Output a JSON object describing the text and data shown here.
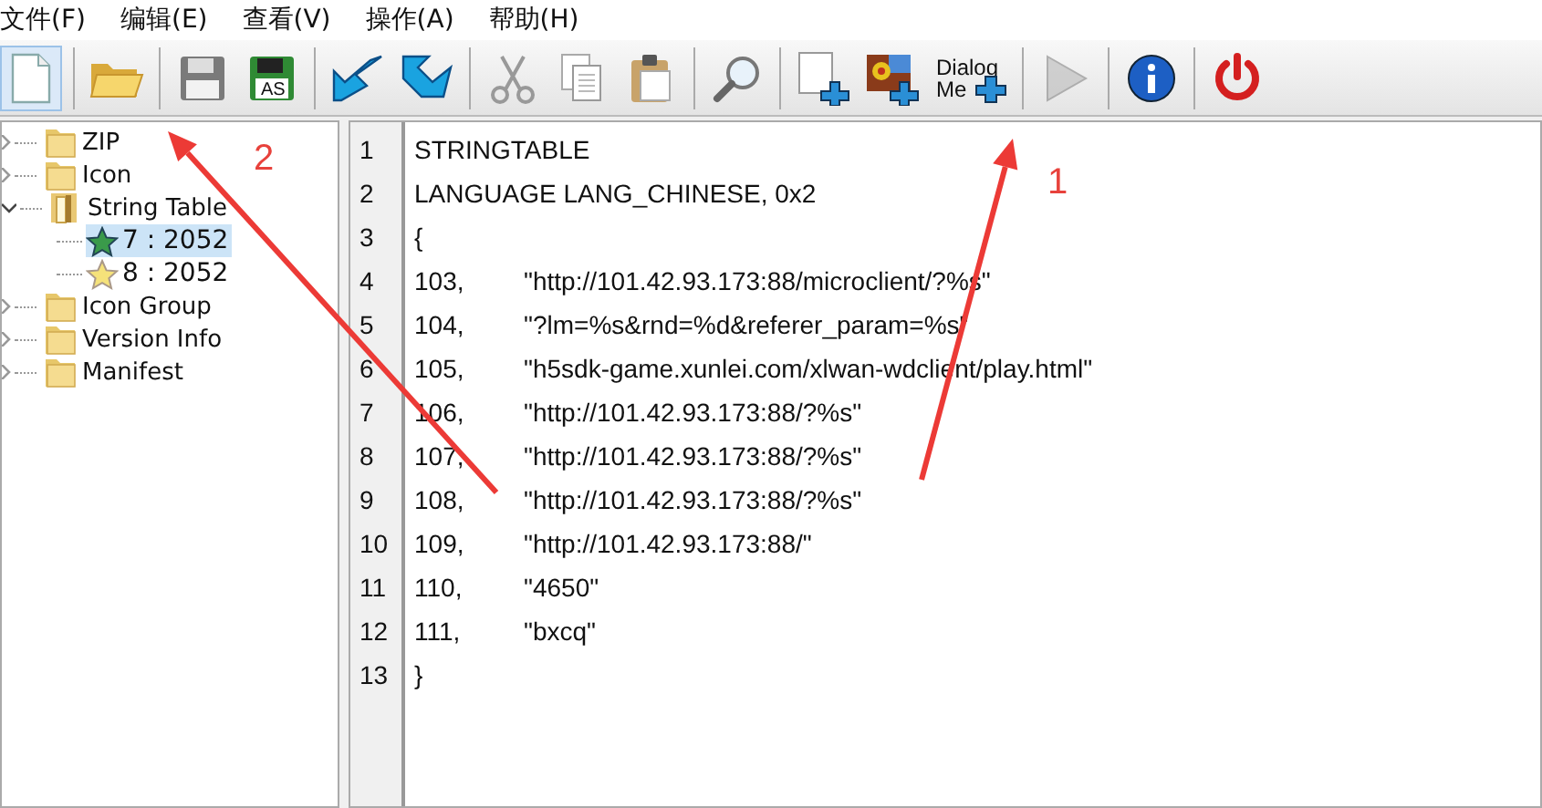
{
  "menu": [
    {
      "label": "文件(F)"
    },
    {
      "label": "编辑(E)"
    },
    {
      "label": "查看(V)"
    },
    {
      "label": "操作(A)"
    },
    {
      "label": "帮助(H)"
    }
  ],
  "toolbar": [
    {
      "kind": "new",
      "hot": true,
      "disabled": false
    },
    {
      "kind": "sep"
    },
    {
      "kind": "open",
      "hot": false,
      "disabled": false
    },
    {
      "kind": "sep"
    },
    {
      "kind": "save",
      "hot": false,
      "disabled": false
    },
    {
      "kind": "saveas",
      "label": "AS",
      "hot": false,
      "disabled": false
    },
    {
      "kind": "sep"
    },
    {
      "kind": "import",
      "hot": false,
      "disabled": false
    },
    {
      "kind": "export",
      "hot": false,
      "disabled": false
    },
    {
      "kind": "sep"
    },
    {
      "kind": "cut",
      "hot": false,
      "disabled": false
    },
    {
      "kind": "copy",
      "hot": false,
      "disabled": false
    },
    {
      "kind": "paste",
      "hot": false,
      "disabled": false
    },
    {
      "kind": "sep"
    },
    {
      "kind": "find",
      "hot": false,
      "disabled": false
    },
    {
      "kind": "sep"
    },
    {
      "kind": "addres",
      "hot": false,
      "disabled": false
    },
    {
      "kind": "addimage",
      "hot": false,
      "disabled": false
    },
    {
      "kind": "dialog",
      "label": "Dialog Me",
      "hot": false,
      "disabled": false
    },
    {
      "kind": "sep"
    },
    {
      "kind": "play",
      "hot": false,
      "disabled": true
    },
    {
      "kind": "sep"
    },
    {
      "kind": "info",
      "hot": false,
      "disabled": false
    },
    {
      "kind": "sep"
    },
    {
      "kind": "power",
      "hot": false,
      "disabled": false
    }
  ],
  "tree": [
    {
      "label": "ZIP",
      "expanded": false
    },
    {
      "label": "Icon",
      "expanded": false
    },
    {
      "label": "String Table",
      "expanded": true,
      "children": [
        {
          "label": "7 : 2052",
          "selected": true
        },
        {
          "label": "8 : 2052",
          "selected": false
        }
      ]
    },
    {
      "label": "Icon Group",
      "expanded": false
    },
    {
      "label": "Version Info",
      "expanded": false
    },
    {
      "label": "Manifest",
      "expanded": false
    }
  ],
  "editor": {
    "lines": [
      {
        "number": "1",
        "text": "STRINGTABLE"
      },
      {
        "number": "2",
        "text": "LANGUAGE LANG_CHINESE, 0x2"
      },
      {
        "number": "3",
        "text": "{"
      },
      {
        "number": "4",
        "text": "103,",
        "value": "\"http://101.42.93.173:88/microclient/?%s\""
      },
      {
        "number": "5",
        "text": "104,",
        "value": "\"?lm=%s&rnd=%d&referer_param=%s\""
      },
      {
        "number": "6",
        "text": "105,",
        "value": "\"h5sdk-game.xunlei.com/xlwan-wdclient/play.html\""
      },
      {
        "number": "7",
        "text": "106,",
        "value": "\"http://101.42.93.173:88/?%s\""
      },
      {
        "number": "8",
        "text": "107,",
        "value": "\"http://101.42.93.173:88/?%s\""
      },
      {
        "number": "9",
        "text": "108,",
        "value": "\"http://101.42.93.173:88/?%s\""
      },
      {
        "number": "10",
        "text": "109,",
        "value": "\"http://101.42.93.173:88/\""
      },
      {
        "number": "11",
        "text": "110,",
        "value": "\"4650\""
      },
      {
        "number": "12",
        "text": "111,",
        "value": "\"bxcq\""
      },
      {
        "number": "13",
        "text": "}"
      }
    ]
  },
  "annotations": [
    {
      "label": "2"
    },
    {
      "label": "1"
    }
  ]
}
